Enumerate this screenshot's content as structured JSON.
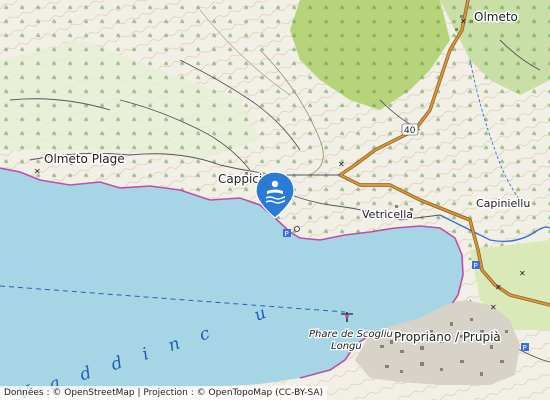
{
  "colors": {
    "sea": "#a6d6e6",
    "coast": "#c04da8",
    "land": "#f2efe6",
    "forest": "#c9dfa7",
    "scrub": "#b7d47b",
    "road_major": "#c8892e",
    "river": "#3b6fd1",
    "marker": "#2b7bd6",
    "contour": "#c9b598"
  },
  "labels": {
    "olmeto": "Olmeto",
    "olmeto_plage": "Olmeto Plage",
    "cappiciolo": "Cappicio",
    "vetricella": "Vetricella",
    "capiniellu": "Capiniellu",
    "propriano": "Propriano / Prupià",
    "phare_line1": "Phare de Scogliu",
    "phare_line2": "Longu",
    "road_ref": "40",
    "sea_name": "Vaddinc u"
  },
  "marker": {
    "icon": "beach-swimmer-icon"
  },
  "attribution": {
    "data_label": "Données : ",
    "osm": "© OpenStreetMap",
    "sep": " | Projection : ",
    "otm": "© OpenTopoMap",
    "license": " (CC-BY-SA)"
  }
}
